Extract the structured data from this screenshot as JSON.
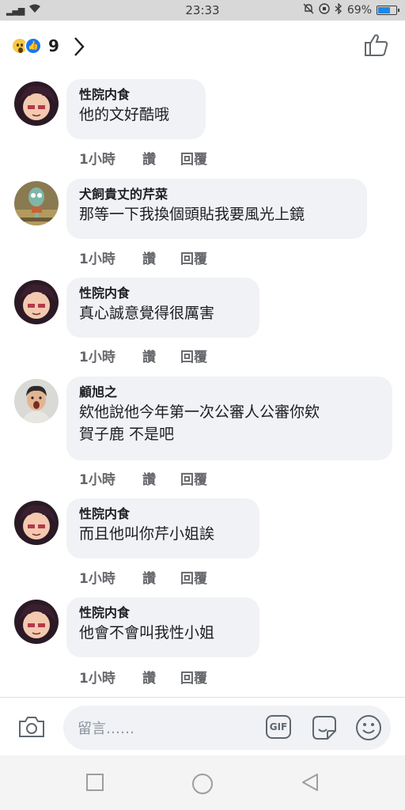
{
  "status_bar": {
    "signal": "ₗₗ|",
    "time": "23:33",
    "battery": "69%",
    "battery_level": 0.69
  },
  "reactions": {
    "count": "9",
    "icons": [
      "wow-reaction-icon",
      "like-reaction-icon"
    ]
  },
  "comments": [
    {
      "name": "性院内食",
      "text": [
        "他的文好酷哦"
      ],
      "time": "1小時",
      "like": "讚",
      "reply": "回覆",
      "avatar": "anime-boy-avatar"
    },
    {
      "name": "犬飼貴丈的芹菜",
      "text": [
        "那等一下我換個頭貼我要風光上鏡"
      ],
      "time": "1小時",
      "like": "讚",
      "reply": "回覆",
      "avatar": "squidward-avatar"
    },
    {
      "name": "性院内食",
      "text": [
        "真心誠意覺得很厲害"
      ],
      "time": "1小時",
      "like": "讚",
      "reply": "回覆",
      "avatar": "anime-boy-avatar"
    },
    {
      "name": "顧旭之",
      "text": [
        "欸他說他今年第一次公審人公審你欸",
        "賀子鹿 不是吧"
      ],
      "time": "1小時",
      "like": "讚",
      "reply": "回覆",
      "avatar": "person-avatar"
    },
    {
      "name": "性院内食",
      "text": [
        "而且他叫你芹小姐誒"
      ],
      "time": "1小時",
      "like": "讚",
      "reply": "回覆",
      "avatar": "anime-boy-avatar"
    },
    {
      "name": "性院内食",
      "text": [
        "他會不會叫我性小姐"
      ],
      "time": "1小時",
      "like": "讚",
      "reply": "回覆",
      "avatar": "anime-boy-avatar"
    }
  ],
  "composer": {
    "placeholder": "留言……",
    "gif_label": "GIF"
  },
  "colors": {
    "bubble": "#f0f2f5",
    "action_text": "#65676b",
    "like_blue": "#1877f2",
    "battery_blue": "#1e88e5"
  }
}
